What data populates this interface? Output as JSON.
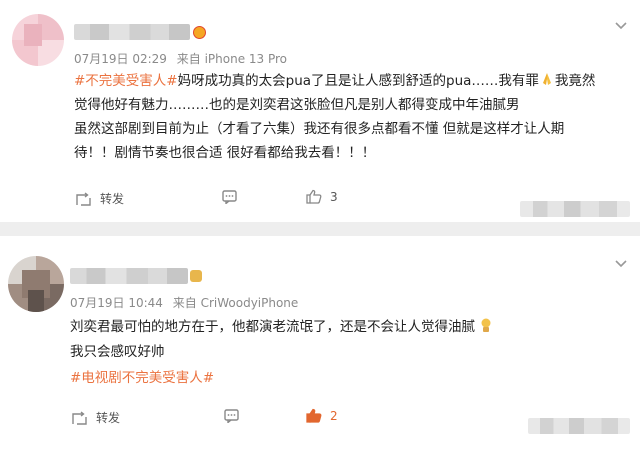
{
  "posts": [
    {
      "meta": {
        "date": "07月19日 02:29",
        "source": "来自 iPhone 13 Pro"
      },
      "lines": [
        {
          "tag": "#不完美受害人#",
          "text": "妈呀成功真的太会pua了且是让人感到舒适的pua……我有罪",
          "after": "我竟然"
        },
        {
          "text": "觉得他好有魅力………也的是刘奕君这张脸但凡是别人都得变成中年油腻男"
        },
        {
          "text": "虽然这部剧到目前为止（才看了六集）我还有很多点都看不懂 但就是这样才让人期"
        },
        {
          "text": "待！！剧情节奏也很合适 很好看都给我去看！！！"
        }
      ],
      "actions": {
        "repost_label": "转发",
        "like_count": "3"
      }
    },
    {
      "meta": {
        "date": "07月19日 10:44",
        "source": "来自 CriWoodyiPhone"
      },
      "lines": [
        {
          "text": "刘奕君最可怕的地方在于，他都演老流氓了，还是不会让人觉得油腻"
        },
        {
          "text": "我只会感叹好帅"
        },
        {
          "tag": "#电视剧不完美受害人#"
        }
      ],
      "actions": {
        "repost_label": "转发",
        "like_count": "2"
      }
    }
  ],
  "colors": {
    "tag": "#eb7340",
    "meta": "#8a8a8a",
    "divider": "#eeeeee",
    "like": "#e2672f"
  },
  "icons": [
    "chevron-down-icon",
    "repost-icon",
    "comment-icon",
    "like-icon",
    "pray-emoji",
    "thinking-emoji"
  ]
}
